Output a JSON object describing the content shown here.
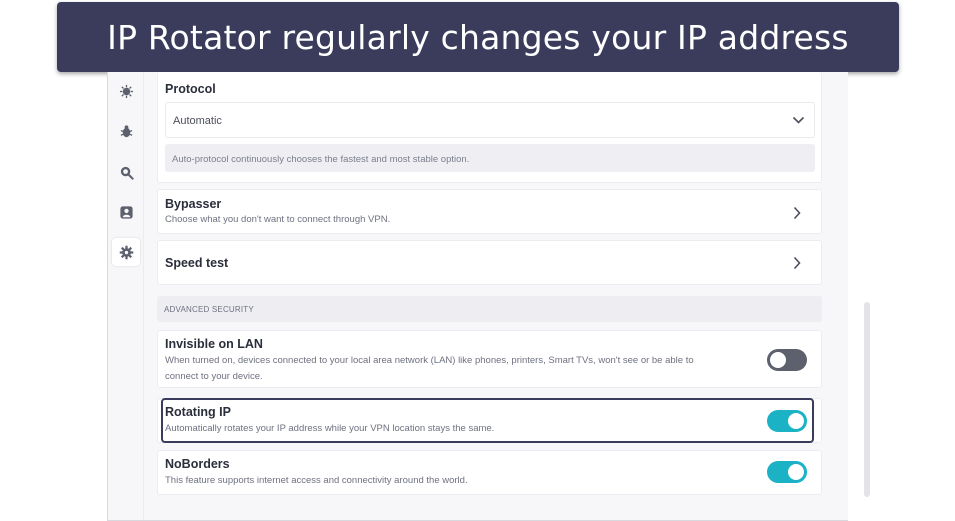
{
  "banner": {
    "text": "IP Rotator regularly changes your IP address"
  },
  "sidebar": {
    "icons": [
      {
        "name": "virus-icon"
      },
      {
        "name": "bug-icon"
      },
      {
        "name": "magnify-icon"
      },
      {
        "name": "profile-icon"
      },
      {
        "name": "gear-icon"
      }
    ]
  },
  "protocol": {
    "title": "Protocol",
    "value": "Automatic",
    "hint": "Auto-protocol continuously chooses the fastest and most stable option."
  },
  "bypasser": {
    "title": "Bypasser",
    "subtitle": "Choose what you don't want to connect through VPN."
  },
  "speed_test": {
    "title": "Speed test"
  },
  "advanced_security": {
    "header": "ADVANCED SECURITY",
    "items": [
      {
        "title": "Invisible on LAN",
        "subtitle_line1": "When turned on, devices connected to your local area network (LAN) like phones, printers, Smart TVs, won't see or be able to",
        "subtitle_line2": "connect to your device.",
        "enabled": false
      },
      {
        "title": "Rotating IP",
        "subtitle": "Automatically rotates your IP address while your VPN location stays the same.",
        "enabled": true
      },
      {
        "title": "NoBorders",
        "subtitle": "This feature supports internet access and connectivity around the world.",
        "enabled": true
      }
    ]
  },
  "colors": {
    "banner": "#3b3c5c",
    "toggle_on": "#1ab2c4",
    "toggle_off": "#5d606d"
  }
}
